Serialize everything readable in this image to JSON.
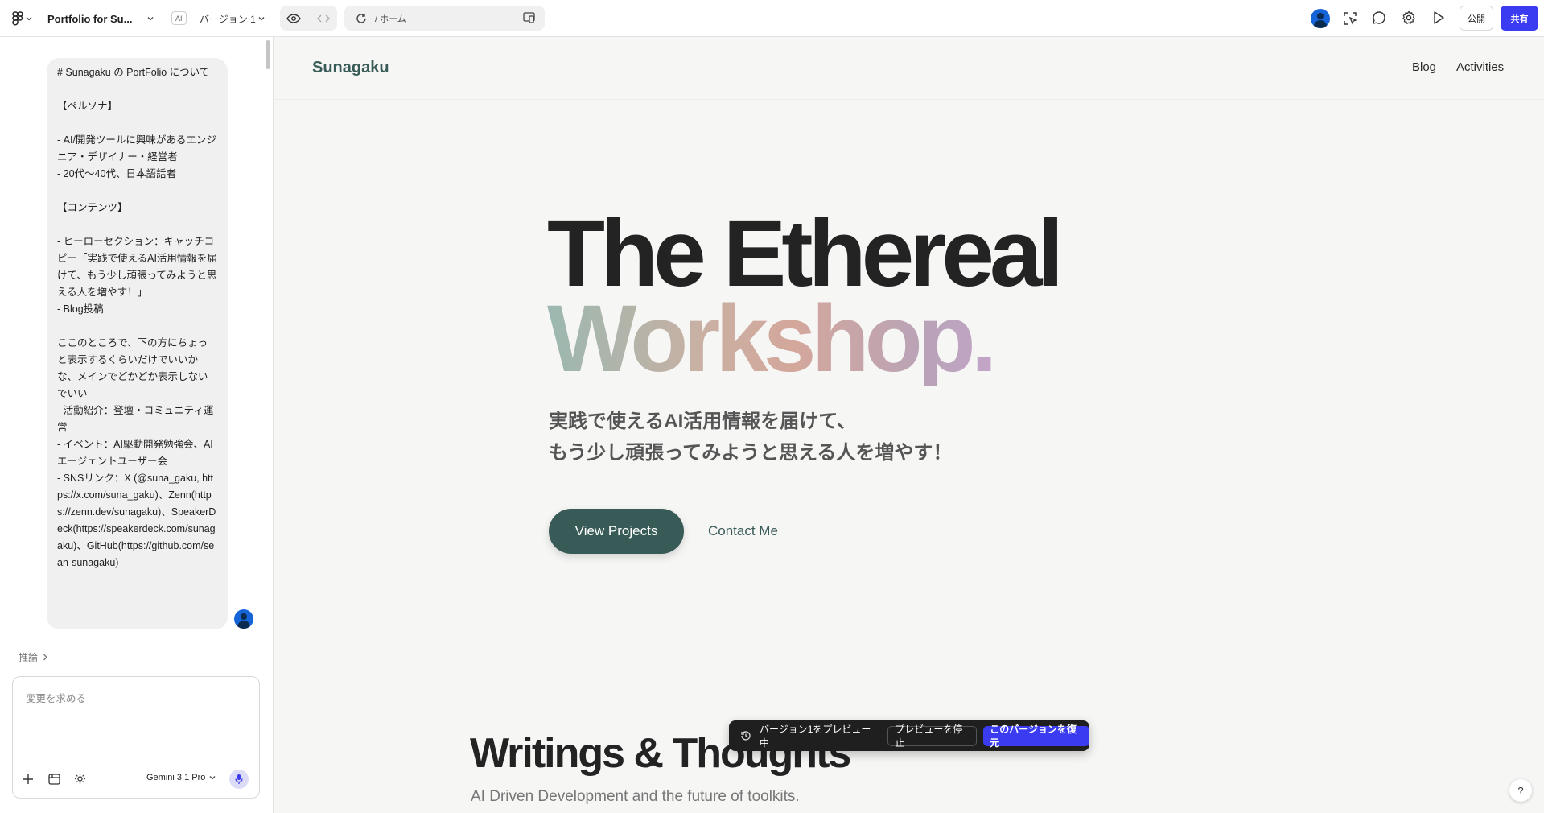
{
  "topbar": {
    "project_title": "Portfolio for Su...",
    "ai_badge": "AI",
    "version_label": "バージョン 1",
    "address_path": "/ ホーム",
    "publish_label": "公開",
    "share_label": "共有"
  },
  "chat": {
    "message": "# Sunagaku の PortFolio について\n\n【ペルソナ】\n\n- AI/開発ツールに興味があるエンジニア・デザイナー・経営者\n- 20代〜40代、日本語話者\n\n【コンテンツ】\n\n- ヒーローセクション：キャッチコピー「実践で使えるAI活用情報を届けて、もう少し頑張ってみようと思える人を増やす！」\n- Blog投稿\n\nここのところで、下の方にちょっと表示するくらいだけでいいかな、メインでどかどか表示しないでいい\n- 活動紹介：登壇・コミュニティ運営\n- イベント：AI駆動開発勉強会、AIエージェントユーザー会\n- SNSリンク：X (@suna_gaku, https://x.com/suna_gaku)、Zenn(https://zenn.dev/sunagaku)、SpeakerDeck(https://speakerdeck.com/sunagaku)、GitHub(https://github.com/sean-sunagaku)",
    "reasoning_label": "推論",
    "input_placeholder": "変更を求める",
    "model_label": "Gemini 3.1 Pro"
  },
  "site": {
    "logo": "Sunagaku",
    "nav": [
      "Blog",
      "Activities"
    ],
    "hero_line1": "The Ethereal",
    "hero_line2": "Workshop.",
    "subtitle_line1": "実践で使えるAI活用情報を届けて、",
    "subtitle_line2": "もう少し頑張ってみようと思える人を増やす！",
    "primary_button": "View Projects",
    "secondary_button": "Contact Me",
    "section_title": "Writings & Thoughts",
    "section_subtitle": "AI Driven Development and the future of toolkits."
  },
  "toast": {
    "status": "バージョン1をプレビュー中",
    "stop_label": "プレビューを停止",
    "restore_label": "このバージョンを復元"
  },
  "help_label": "?",
  "colors": {
    "accent": "#3b3bf2",
    "button_teal": "#385b58",
    "toast_bg": "#1f1f1f"
  }
}
